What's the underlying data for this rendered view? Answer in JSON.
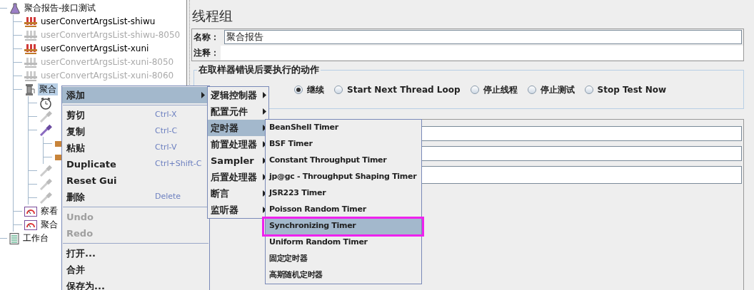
{
  "tree": [
    {
      "label": "聚合报告-接口测试",
      "kind": "flask",
      "children": [
        {
          "label": "userConvertArgsList-shiwu",
          "kind": "rack",
          "disabled": false
        },
        {
          "label": "userConvertArgsList-shiwu-8050",
          "kind": "rack",
          "disabled": true
        },
        {
          "label": "userConvertArgsList-xuni",
          "kind": "rack",
          "disabled": false
        },
        {
          "label": "userConvertArgsList-xuni-8050",
          "kind": "rack",
          "disabled": true
        },
        {
          "label": "userConvertArgsList-xuni-8060",
          "kind": "rack",
          "disabled": true
        },
        {
          "label": "聚合",
          "kind": "spool",
          "selected": true,
          "children": [
            {
              "kind": "timer",
              "disabled": false
            },
            {
              "kind": "pipette",
              "disabled": true
            },
            {
              "kind": "pipette",
              "disabled": false,
              "children": [
                {
                  "kind": "leaf"
                },
                {
                  "kind": "leaf"
                }
              ]
            },
            {
              "kind": "pipette",
              "disabled": true
            },
            {
              "kind": "pipette",
              "disabled": true
            },
            {
              "kind": "pipette",
              "disabled": true
            }
          ]
        },
        {
          "label": "察看",
          "kind": "gauge",
          "disabled": false
        },
        {
          "label": "聚合",
          "kind": "gauge",
          "disabled": false
        }
      ]
    },
    {
      "label": "工作台",
      "kind": "notepad"
    }
  ],
  "panel": {
    "title": "线程组",
    "name_label": "名称：",
    "name_value": "聚合报告",
    "comment_label": "注释：",
    "group_title": "在取样器错误后要执行的动作",
    "radios": [
      {
        "label": "继续",
        "selected": true
      },
      {
        "label": "Start Next Thread Loop",
        "selected": false
      },
      {
        "label": "停止线程",
        "selected": false
      },
      {
        "label": "停止测试",
        "selected": false
      },
      {
        "label": "Stop Test Now",
        "selected": false
      }
    ]
  },
  "context_menu": [
    {
      "kind": "submenu",
      "label": "添加",
      "selected": true
    },
    {
      "kind": "separator"
    },
    {
      "kind": "item",
      "label": "剪切",
      "shortcut": "Ctrl-X",
      "disabled": false
    },
    {
      "kind": "item",
      "label": "复制",
      "shortcut": "Ctrl-C",
      "disabled": false
    },
    {
      "kind": "item",
      "label": "粘贴",
      "shortcut": "Ctrl-V",
      "disabled": false
    },
    {
      "kind": "item",
      "label": "Duplicate",
      "shortcut": "Ctrl+Shift-C",
      "disabled": false
    },
    {
      "kind": "item",
      "label": "Reset Gui",
      "disabled": false
    },
    {
      "kind": "item",
      "label": "删除",
      "shortcut": "Delete",
      "disabled": false
    },
    {
      "kind": "separator"
    },
    {
      "kind": "item",
      "label": "Undo",
      "disabled": true
    },
    {
      "kind": "item",
      "label": "Redo",
      "disabled": true
    },
    {
      "kind": "separator"
    },
    {
      "kind": "item",
      "label": "打开...",
      "disabled": false
    },
    {
      "kind": "item",
      "label": "合并",
      "disabled": false
    },
    {
      "kind": "item",
      "label": "保存为...",
      "disabled": false
    }
  ],
  "add_menu": [
    {
      "label": "逻辑控制器",
      "selected": false
    },
    {
      "label": "配置元件",
      "selected": false
    },
    {
      "label": "定时器",
      "selected": true
    },
    {
      "label": "前置处理器",
      "selected": false
    },
    {
      "label": "Sampler",
      "selected": false
    },
    {
      "label": "后置处理器",
      "selected": false
    },
    {
      "label": "断言",
      "selected": false
    },
    {
      "label": "监听器",
      "selected": false
    }
  ],
  "timer_menu": [
    {
      "label": "BeanShell Timer",
      "selected": false
    },
    {
      "label": "BSF Timer",
      "selected": false
    },
    {
      "label": "Constant Throughput Timer",
      "selected": false
    },
    {
      "label": "jp@gc - Throughput Shaping Timer",
      "selected": false
    },
    {
      "label": "JSR223 Timer",
      "selected": false
    },
    {
      "label": "Poisson Random Timer",
      "selected": false
    },
    {
      "label": "Synchronizing Timer",
      "selected": true,
      "highlighted": true
    },
    {
      "label": "Uniform Random Timer",
      "selected": false
    },
    {
      "label": "固定定时器",
      "selected": false
    },
    {
      "label": "高斯随机定时器",
      "selected": false
    }
  ]
}
